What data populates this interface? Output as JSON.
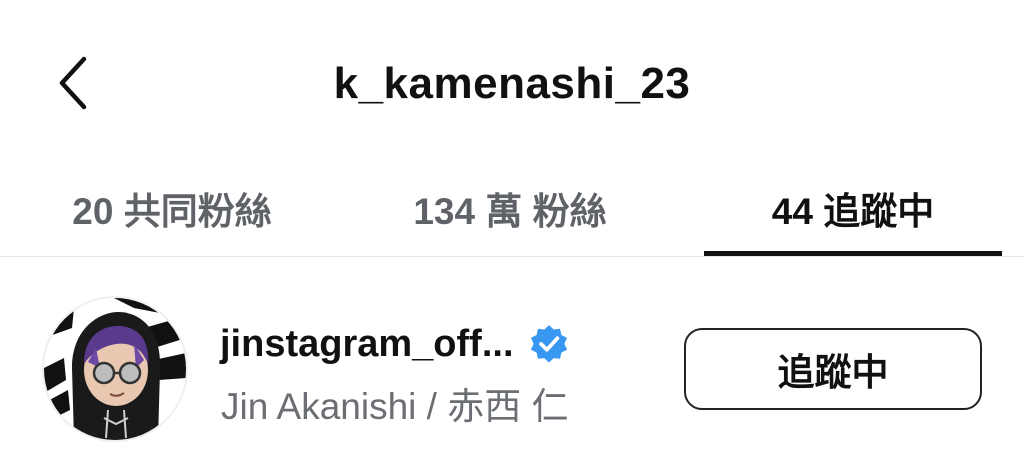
{
  "header": {
    "title": "k_kamenashi_23",
    "back_icon": "chevron-left-icon"
  },
  "tabs": [
    {
      "label": "20 共同粉絲",
      "active": false
    },
    {
      "label": "134 萬 粉絲",
      "active": false
    },
    {
      "label": "44 追蹤中",
      "active": true
    }
  ],
  "following_list": [
    {
      "username": "jinstagram_off...",
      "verified": true,
      "full_name": "Jin Akanishi / 赤西 仁",
      "button_label": "追蹤中"
    }
  ],
  "colors": {
    "verified_badge": "#3897f0",
    "secondary_text": "#6b6f74",
    "tab_inactive": "#5f6368"
  }
}
